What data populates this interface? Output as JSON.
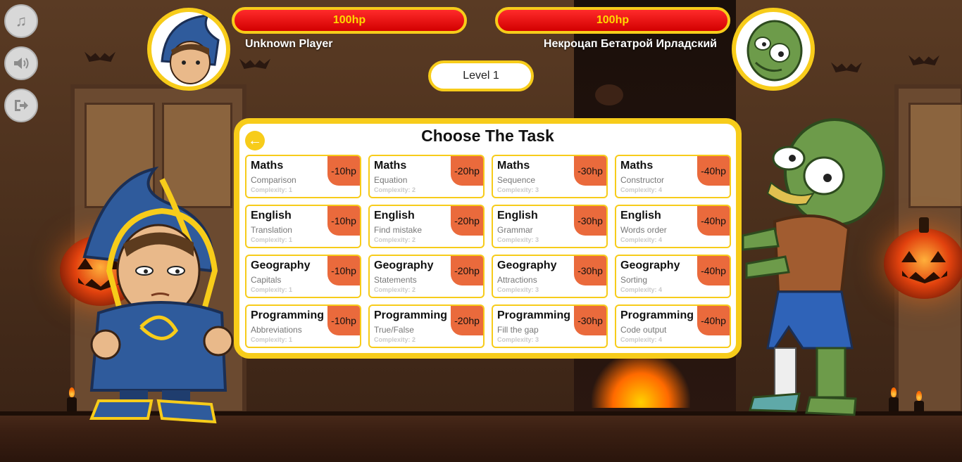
{
  "hud": {
    "player": {
      "hp": "100hp",
      "name": "Unknown Player"
    },
    "enemy": {
      "hp": "100hp",
      "name": "Некроцап Бетатрой Ирладский"
    },
    "level": "Level 1"
  },
  "side_buttons": [
    {
      "icon": "music-note-icon"
    },
    {
      "icon": "volume-icon"
    },
    {
      "icon": "exit-icon"
    }
  ],
  "panel": {
    "title": "Choose The Task",
    "back_icon": "arrow-left-icon",
    "complexity_prefix": "Complexity: ",
    "tasks": [
      {
        "subject": "Maths",
        "topic": "Comparison",
        "complexity": "Complexity: 1",
        "cost": "-10hp"
      },
      {
        "subject": "Maths",
        "topic": "Equation",
        "complexity": "Complexity: 2",
        "cost": "-20hp"
      },
      {
        "subject": "Maths",
        "topic": "Sequence",
        "complexity": "Complexity: 3",
        "cost": "-30hp"
      },
      {
        "subject": "Maths",
        "topic": "Constructor",
        "complexity": "Complexity: 4",
        "cost": "-40hp"
      },
      {
        "subject": "English",
        "topic": "Translation",
        "complexity": "Complexity: 1",
        "cost": "-10hp"
      },
      {
        "subject": "English",
        "topic": "Find mistake",
        "complexity": "Complexity: 2",
        "cost": "-20hp"
      },
      {
        "subject": "English",
        "topic": "Grammar",
        "complexity": "Complexity: 3",
        "cost": "-30hp"
      },
      {
        "subject": "English",
        "topic": "Words order",
        "complexity": "Complexity: 4",
        "cost": "-40hp"
      },
      {
        "subject": "Geography",
        "topic": "Capitals",
        "complexity": "Complexity: 1",
        "cost": "-10hp"
      },
      {
        "subject": "Geography",
        "topic": "Statements",
        "complexity": "Complexity: 2",
        "cost": "-20hp"
      },
      {
        "subject": "Geography",
        "topic": "Attractions",
        "complexity": "Complexity: 3",
        "cost": "-30hp"
      },
      {
        "subject": "Geography",
        "topic": "Sorting",
        "complexity": "Complexity: 4",
        "cost": "-40hp"
      },
      {
        "subject": "Programming",
        "topic": "Abbreviations",
        "complexity": "Complexity: 1",
        "cost": "-10hp"
      },
      {
        "subject": "Programming",
        "topic": "True/False",
        "complexity": "Complexity: 2",
        "cost": "-20hp"
      },
      {
        "subject": "Programming",
        "topic": "Fill the gap",
        "complexity": "Complexity: 3",
        "cost": "-30hp"
      },
      {
        "subject": "Programming",
        "topic": "Code output",
        "complexity": "Complexity: 4",
        "cost": "-40hp"
      }
    ]
  },
  "colors": {
    "accent": "#f7cc1a",
    "hp_bar": "#e00000",
    "cost_badge": "#ea6a3c"
  }
}
